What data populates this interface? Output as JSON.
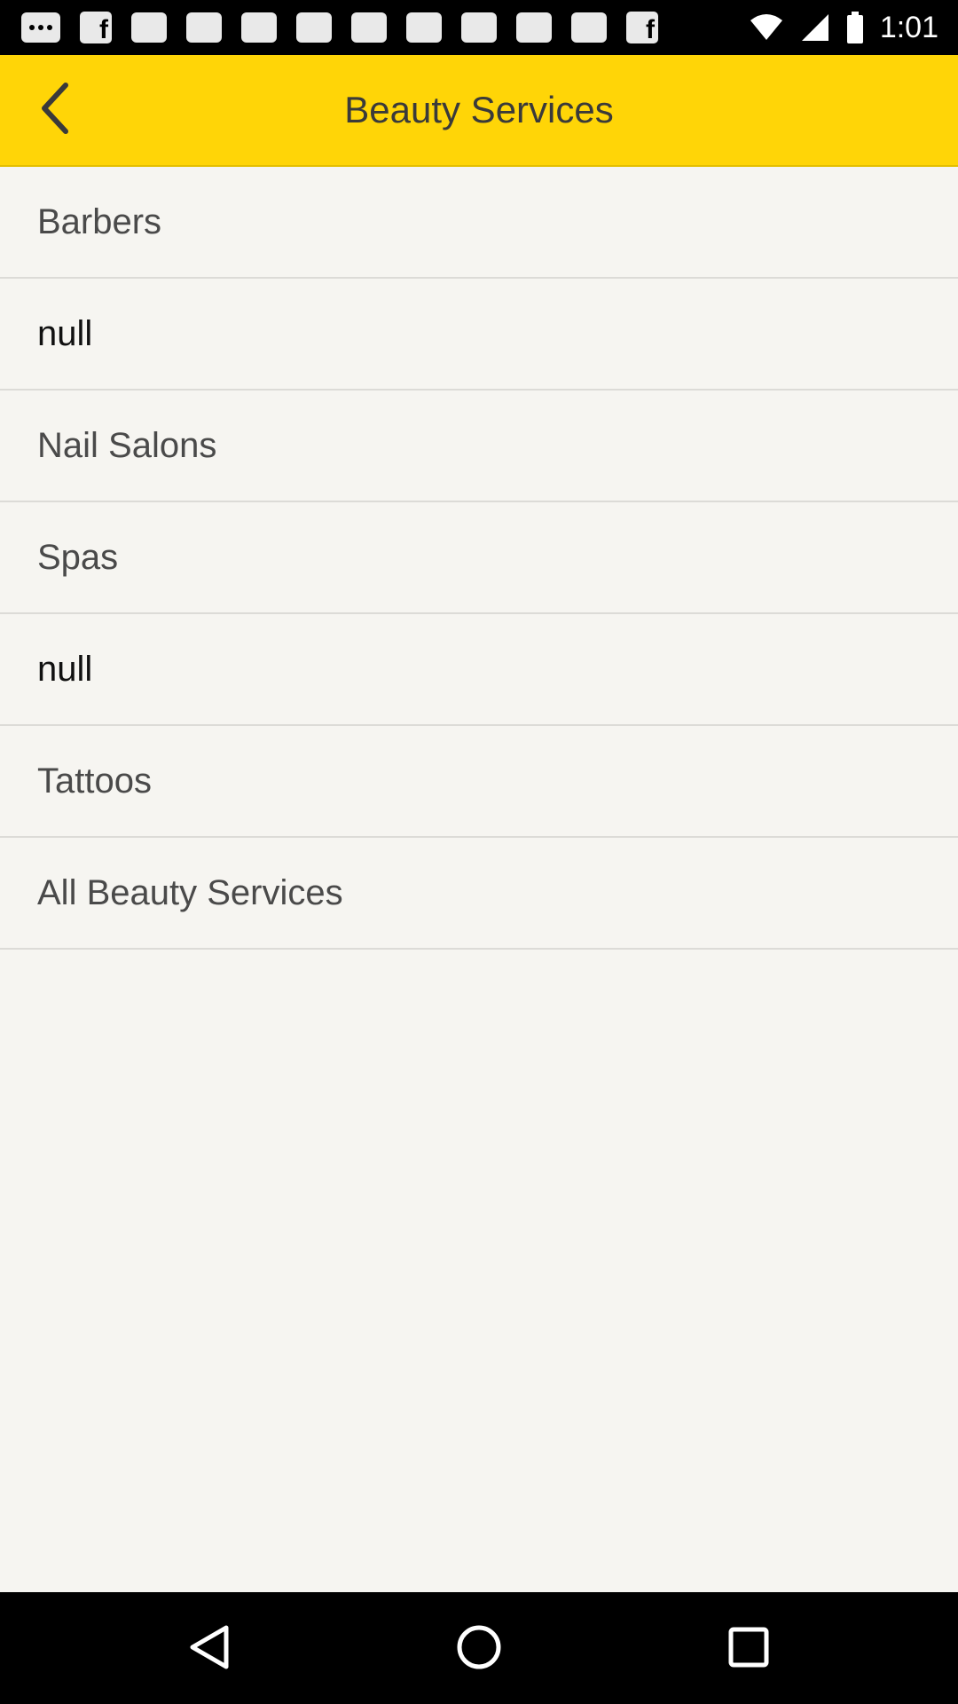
{
  "status_bar": {
    "time": "1:01",
    "left_icons": [
      "more-dots-icon",
      "message-icon",
      "message-icon",
      "message-icon",
      "message-icon",
      "message-icon",
      "message-icon",
      "message-icon",
      "message-icon",
      "message-icon",
      "message-icon",
      "facebook-icon"
    ],
    "right_icons": [
      "wifi-icon",
      "signal-icon",
      "battery-icon"
    ]
  },
  "app_bar": {
    "title": "Beauty Services",
    "back_icon": "chevron-left-icon",
    "color": "#ffd507"
  },
  "list": {
    "items": [
      {
        "label": "Barbers"
      },
      {
        "label": "null"
      },
      {
        "label": "Nail Salons"
      },
      {
        "label": "Spas"
      },
      {
        "label": "null"
      },
      {
        "label": "Tattoos"
      },
      {
        "label": "All Beauty Services"
      }
    ]
  },
  "nav_bar": {
    "buttons": [
      "back-triangle-icon",
      "home-circle-icon",
      "recents-square-icon"
    ]
  }
}
